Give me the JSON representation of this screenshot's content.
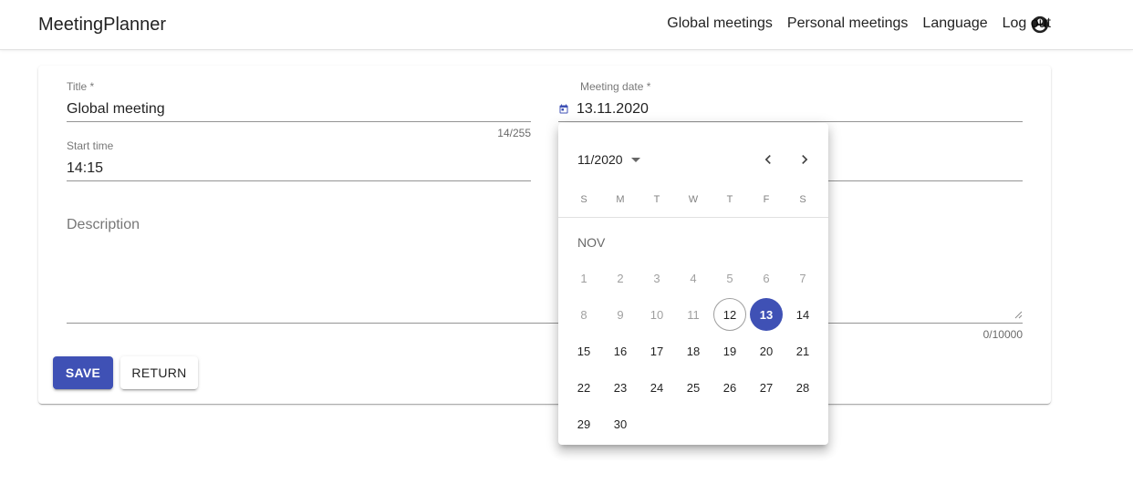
{
  "header": {
    "brand": "MeetingPlanner",
    "nav": [
      "Global meetings",
      "Personal meetings",
      "Language",
      "Log out"
    ],
    "account_icon": "account-circle-icon"
  },
  "form": {
    "title": {
      "label": "Title *",
      "value": "Global meeting",
      "counter": "14/255"
    },
    "meeting_date": {
      "label": "Meeting date *",
      "value": "13.11.2020",
      "icon": "calendar-icon"
    },
    "start_time": {
      "label": "Start time",
      "value": "14:15"
    },
    "description": {
      "label": "Description",
      "counter": "0/10000"
    },
    "save_label": "SAVE",
    "return_label": "RETURN"
  },
  "datepicker": {
    "period": "11/2020",
    "weekdays": [
      "S",
      "M",
      "T",
      "W",
      "T",
      "F",
      "S"
    ],
    "month_label": "NOV",
    "days": [
      1,
      2,
      3,
      4,
      5,
      6,
      7,
      8,
      9,
      10,
      11,
      12,
      13,
      14,
      15,
      16,
      17,
      18,
      19,
      20,
      21,
      22,
      23,
      24,
      25,
      26,
      27,
      28,
      29,
      30
    ],
    "disabled_before": 12,
    "today": 12,
    "selected": 13
  },
  "colors": {
    "primary": "#3f51b5"
  }
}
